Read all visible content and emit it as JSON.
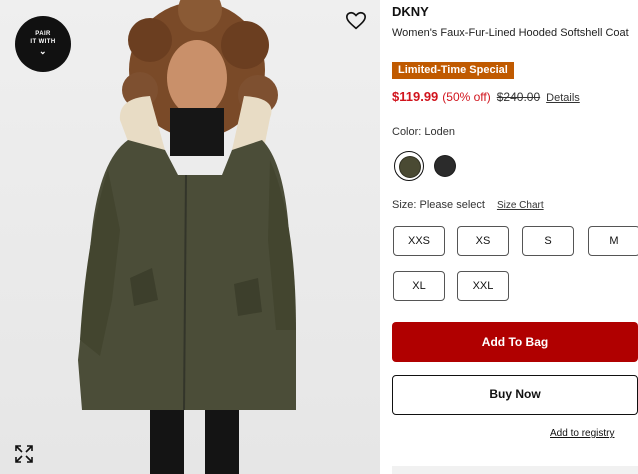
{
  "image_panel": {
    "pair_badge": {
      "line1": "PAIR",
      "line2": "IT WITH"
    }
  },
  "product": {
    "brand": "DKNY",
    "title": "Women's Faux-Fur-Lined Hooded Softshell Coat",
    "promo_badge": "Limited-Time Special",
    "sale_price": "$119.99",
    "discount": "(50% off)",
    "original_price": "$240.00",
    "details_link": "Details",
    "color_label": "Color: Loden",
    "swatches": [
      {
        "name": "Loden",
        "color": "#4a4a33",
        "selected": true
      },
      {
        "name": "Black",
        "color": "#2b2b2b",
        "selected": false
      }
    ],
    "size_label": "Size: Please select",
    "size_chart_link": "Size Chart",
    "sizes": [
      "XXS",
      "XS",
      "S",
      "M",
      "XL",
      "XXL"
    ]
  },
  "actions": {
    "add_to_bag": "Add To Bag",
    "buy_now": "Buy Now",
    "registry": "Add to registry"
  },
  "colors": {
    "promo": "#c05a00",
    "sale_red": "#d1141d",
    "cta_red": "#b00000"
  }
}
